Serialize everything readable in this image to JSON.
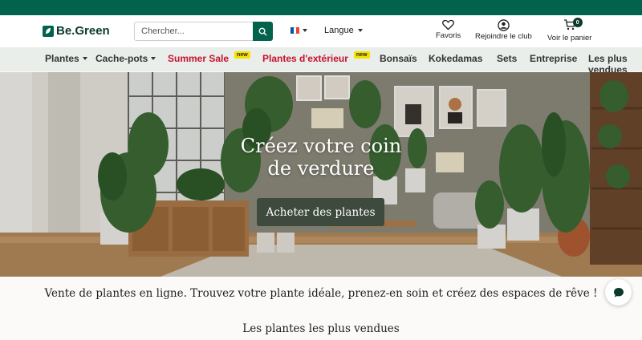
{
  "header": {
    "logo_text": "Be.Green",
    "search": {
      "placeholder": "Chercher..."
    },
    "language": {
      "selected": "Langue"
    },
    "favorites_label": "Favoris",
    "club_label": "Rejoindre le club",
    "cart_label": "Voir le panier",
    "cart_count": "0"
  },
  "nav": {
    "items": [
      {
        "label": "Plantes"
      },
      {
        "label": "Cache-pots"
      },
      {
        "label": "Summer Sale",
        "badge": "new"
      },
      {
        "label": "Plantes d'extérieur",
        "badge": "new"
      },
      {
        "label": "Bonsaïs"
      },
      {
        "label": "Kokedamas"
      },
      {
        "label": "Sets"
      },
      {
        "label": "Entreprise"
      },
      {
        "label": "Les plus vendues"
      }
    ]
  },
  "hero": {
    "title_line1": "Créez votre coin",
    "title_line2": "de verdure",
    "cta": "Acheter des plantes"
  },
  "tagline": "Vente de plantes en ligne. Trouvez votre plante idéale, prenez-en soin et créez des espaces de rêve !",
  "section_title": "Les plantes les plus vendues",
  "colors": {
    "brand": "#03624c",
    "nav_bg": "#e9eeeb",
    "sale_red": "#c8102e",
    "badge_yellow": "#f5e000"
  }
}
